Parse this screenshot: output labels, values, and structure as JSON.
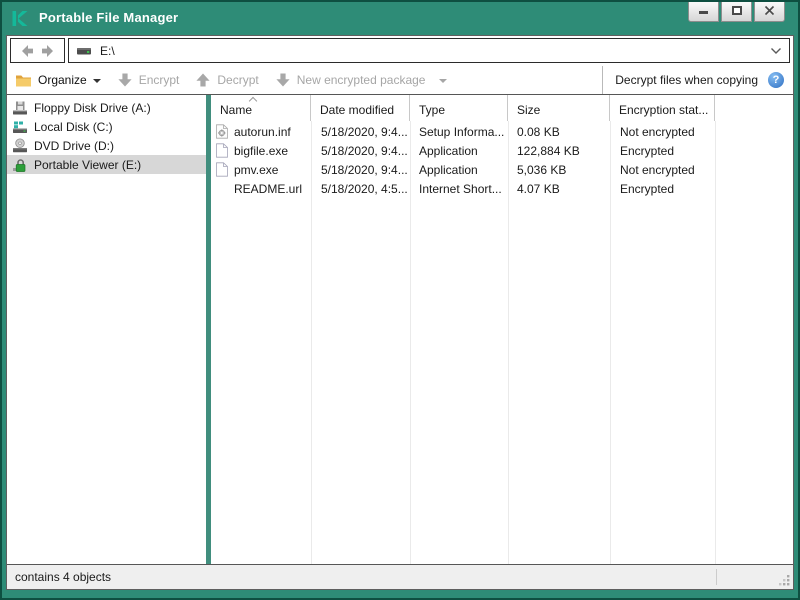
{
  "window": {
    "title": "Portable File Manager",
    "controls": {
      "minimize": "minimize",
      "maximize": "maximize",
      "close": "close"
    }
  },
  "address_bar": {
    "path": "E:\\"
  },
  "toolbar": {
    "organize_label": "Organize",
    "encrypt_label": "Encrypt",
    "decrypt_label": "Decrypt",
    "new_package_label": "New encrypted package",
    "decrypt_when_copying_label": "Decrypt files when copying",
    "help_glyph": "?"
  },
  "sidebar": {
    "items": [
      {
        "label": "Floppy Disk Drive (A:)",
        "icon": "floppy-drive-icon",
        "selected": false
      },
      {
        "label": "Local Disk (C:)",
        "icon": "hard-disk-icon",
        "selected": false
      },
      {
        "label": "DVD Drive (D:)",
        "icon": "dvd-drive-icon",
        "selected": false
      },
      {
        "label": "Portable Viewer (E:)",
        "icon": "lock-icon",
        "selected": true
      }
    ]
  },
  "file_list": {
    "columns": [
      "Name",
      "Date modified",
      "Type",
      "Size",
      "Encryption stat..."
    ],
    "sort_column": "Name",
    "sort_direction": "ascending",
    "rows": [
      {
        "icon": "setup-file-icon",
        "name": "autorun.inf",
        "date_modified": "5/18/2020, 9:4...",
        "type": "Setup Informa...",
        "size": "0.08 KB",
        "encryption_status": "Not encrypted"
      },
      {
        "icon": "file-icon",
        "name": "bigfile.exe",
        "date_modified": "5/18/2020, 9:4...",
        "type": "Application",
        "size": "122,884 KB",
        "encryption_status": "Encrypted"
      },
      {
        "icon": "file-icon",
        "name": "pmv.exe",
        "date_modified": "5/18/2020, 9:4...",
        "type": "Application",
        "size": "5,036 KB",
        "encryption_status": "Not encrypted"
      },
      {
        "icon": "none",
        "name": "README.url",
        "date_modified": "5/18/2020, 4:5...",
        "type": "Internet Short...",
        "size": "4.07 KB",
        "encryption_status": "Encrypted"
      }
    ]
  },
  "status_bar": {
    "text": "contains 4 objects"
  },
  "colors": {
    "titlebar_teal": "#2e8c77",
    "frame_border": "#0e4f41",
    "logo_green": "#14b99a",
    "splitter_teal": "#418e7e",
    "selected_item_bg": "#d7d7d7",
    "disabled_text": "#a6a6a6",
    "help_icon_blue": "#2f6fc2",
    "lock_green": "#2d9e3a",
    "statusbar_bg": "#efefef"
  }
}
